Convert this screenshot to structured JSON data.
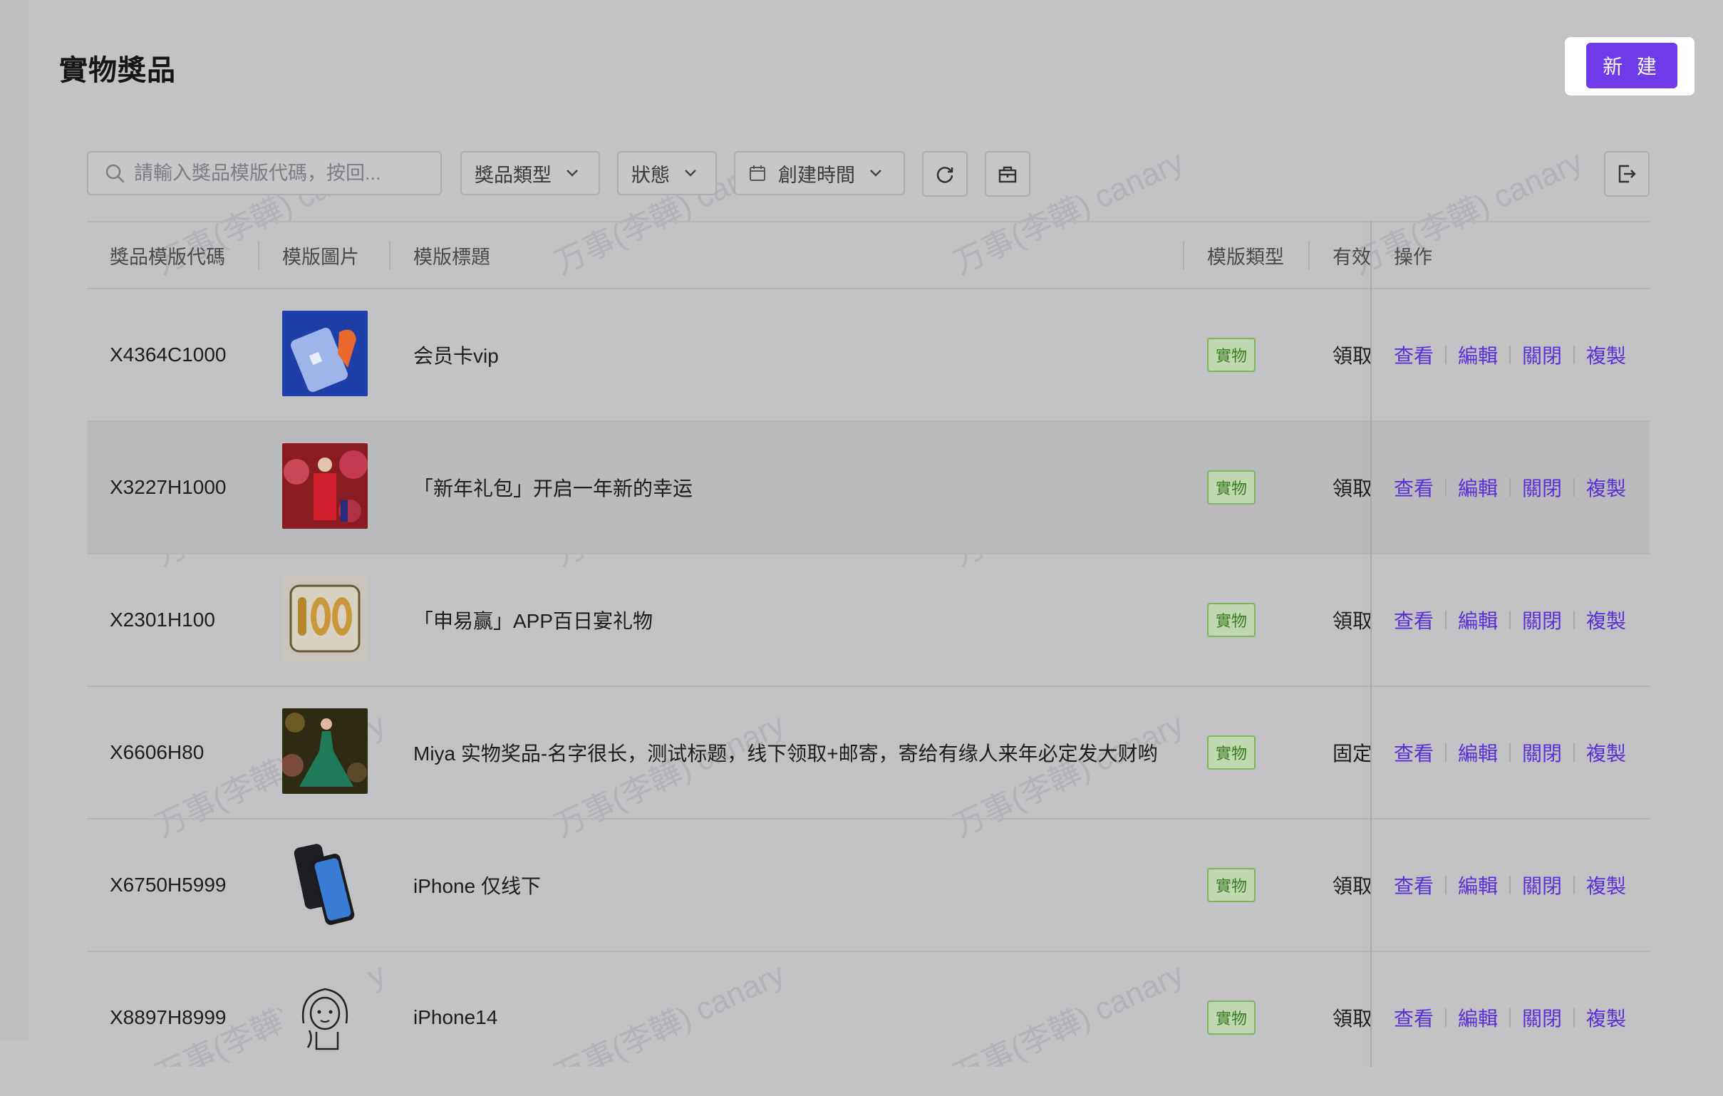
{
  "header": {
    "title": "實物獎品",
    "new_button": "新 建"
  },
  "toolbar": {
    "search_placeholder": "請輸入獎品模版代碼，按回...",
    "filters": [
      {
        "label": "獎品類型"
      },
      {
        "label": "狀態"
      },
      {
        "label": "創建時間"
      }
    ],
    "icons": [
      "search-icon",
      "chevron-down-icon",
      "calendar-icon",
      "refresh-icon",
      "gift-icon",
      "export-icon"
    ]
  },
  "table": {
    "columns": [
      "獎品模版代碼",
      "模版圖片",
      "模版標題",
      "模版類型",
      "有效",
      "操作"
    ],
    "actions": [
      "查看",
      "編輯",
      "關閉",
      "複製"
    ],
    "rows": [
      {
        "code": "X4364C1000",
        "title": "会员卡vip",
        "type": "實物",
        "valid": "領取",
        "image": "vip-card-image"
      },
      {
        "code": "X3227H1000",
        "title": "「新年礼包」开启一年新的幸运",
        "type": "實物",
        "valid": "領取",
        "image": "new-year-image"
      },
      {
        "code": "X2301H100",
        "title": "「申易赢」APP百日宴礼物",
        "type": "實物",
        "valid": "領取",
        "image": "balloon-100-image"
      },
      {
        "code": "X6606H80",
        "title": "Miya 实物奖品-名字很长，测试标题，线下领取+邮寄，寄给有缘人来年必定发大财哟",
        "type": "實物",
        "valid": "固定",
        "image": "stage-dress-image"
      },
      {
        "code": "X6750H5999",
        "title": "iPhone 仅线下",
        "type": "實物",
        "valid": "領取",
        "image": "iphone-image"
      },
      {
        "code": "X8897H8999",
        "title": "iPhone14",
        "type": "實物",
        "valid": "領取",
        "image": "sketch-girl-image"
      }
    ]
  },
  "watermark": "万事(李韡) canary",
  "colors": {
    "accent": "#6f3be8",
    "link": "#5b2fd6",
    "tag_border": "#7cb35e",
    "tag_text": "#3b7d22",
    "overlay": "#c3c3c6"
  }
}
